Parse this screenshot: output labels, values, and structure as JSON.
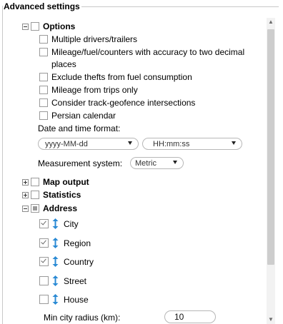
{
  "panel": {
    "title": "Advanced settings"
  },
  "options": {
    "label": "Options",
    "items": [
      {
        "label": "Multiple drivers/trailers",
        "checked": false
      },
      {
        "label": "Mileage/fuel/counters with accuracy to two decimal",
        "checked": false
      },
      {
        "label": "Exclude thefts from fuel consumption",
        "checked": false
      },
      {
        "label": "Mileage from trips only",
        "checked": false
      },
      {
        "label": "Consider track-geofence intersections",
        "checked": false
      },
      {
        "label": "Persian calendar",
        "checked": false
      }
    ],
    "mileage_cont": "places",
    "date_time_label": "Date and time format:",
    "date_format": "yyyy-MM-dd",
    "time_format": "HH:mm:ss",
    "measurement_label": "Measurement system:",
    "measurement_value": "Metric"
  },
  "sections": {
    "map_output": "Map output",
    "statistics": "Statistics",
    "address": "Address"
  },
  "address_items": [
    {
      "label": "City",
      "checked": true
    },
    {
      "label": "Region",
      "checked": true
    },
    {
      "label": "Country",
      "checked": true
    },
    {
      "label": "Street",
      "checked": false
    },
    {
      "label": "House",
      "checked": false
    }
  ],
  "min_city_radius": {
    "label": "Min city radius (km):",
    "value": "10"
  },
  "colors": {
    "accent_icon": "#2a8ad4",
    "border": "#b7b7b7"
  },
  "icons": {
    "sort": "up-down-arrow-icon",
    "expander_minus": "minus-box-icon",
    "expander_plus": "plus-box-icon"
  }
}
